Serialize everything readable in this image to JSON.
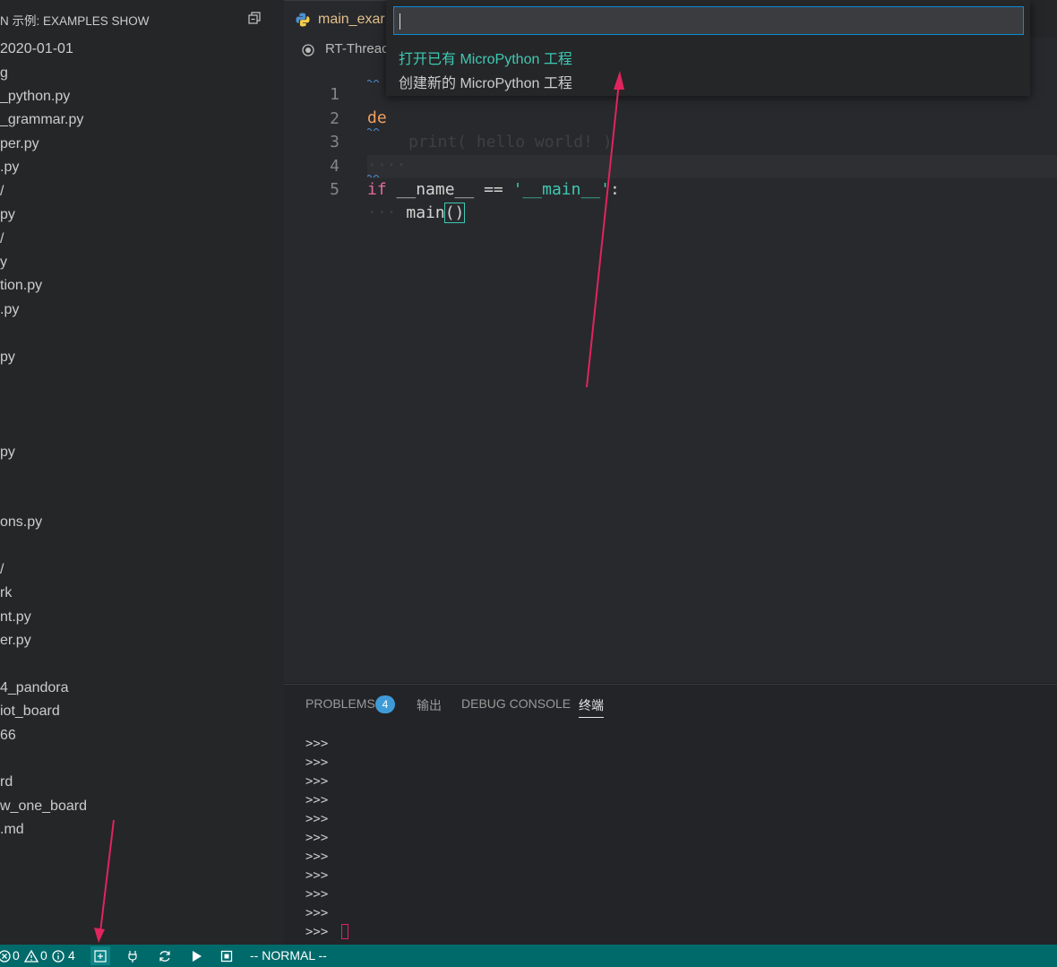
{
  "sidebar": {
    "title": "N 示例: EXAMPLES SHOW",
    "items": [
      {
        "label": "2020-01-01"
      },
      {
        "label": "g"
      },
      {
        "label": "_python.py"
      },
      {
        "label": "_grammar.py"
      },
      {
        "label": "per.py"
      },
      {
        "label": ".py"
      },
      {
        "label": "/"
      },
      {
        "label": "py"
      },
      {
        "label": "/"
      },
      {
        "label": "y"
      },
      {
        "label": "tion.py"
      },
      {
        "label": ".py"
      },
      {
        "label": "py"
      },
      {
        "label": "py"
      },
      {
        "label": "ons.py"
      },
      {
        "label": "/"
      },
      {
        "label": "rk"
      },
      {
        "label": "nt.py"
      },
      {
        "label": "er.py"
      },
      {
        "label": "4_pandora"
      },
      {
        "label": "iot_board"
      },
      {
        "label": "66"
      },
      {
        "label": "rd"
      },
      {
        "label": "w_one_board"
      },
      {
        "label": ".md"
      }
    ]
  },
  "editor": {
    "tab_label": "main_exar",
    "breadcrumb": "RT-Threac",
    "line_numbers": [
      "1",
      "2",
      "3",
      "4",
      "5"
    ],
    "code": {
      "line1_kw": "de",
      "line2_text": "print( hello world! )",
      "line3_text": "····",
      "line4_if": "if",
      "line4_name": "__name__",
      "line4_op": " == ",
      "line4_str": "'__main__'",
      "line4_colon": ":",
      "line5_indent": "···",
      "line5_call": "main",
      "line5_parens": "()"
    }
  },
  "palette": {
    "input_value": "",
    "items": [
      {
        "label": "打开已有 MicroPython 工程",
        "color": "#3ec9b3"
      },
      {
        "label": "创建新的 MicroPython 工程",
        "color": "#cccccc"
      }
    ]
  },
  "panel": {
    "tabs": [
      "PROBLEMS",
      "输出",
      "DEBUG CONSOLE",
      "终端"
    ],
    "problems_count": "4",
    "active_tab": "终端",
    "terminal_lines": [
      ">>>",
      ">>>",
      ">>>",
      ">>>",
      ">>>",
      ">>>",
      ">>>",
      ">>>",
      ">>>",
      ">>>",
      ">>>"
    ]
  },
  "status_bar": {
    "errors": "0",
    "warnings": "0",
    "infos": "4",
    "mode": "-- NORMAL --"
  },
  "colors": {
    "accent_teal": "#006a6b",
    "annotation_arrow": "#e0245e",
    "focus_border": "#0e8ad4"
  },
  "icons": [
    "collapse-all-icon",
    "python-file-icon",
    "circle-dot-icon",
    "error-icon",
    "warning-icon",
    "info-icon",
    "new-project-icon",
    "plug-icon",
    "sync-icon",
    "run-icon",
    "stop-icon"
  ]
}
